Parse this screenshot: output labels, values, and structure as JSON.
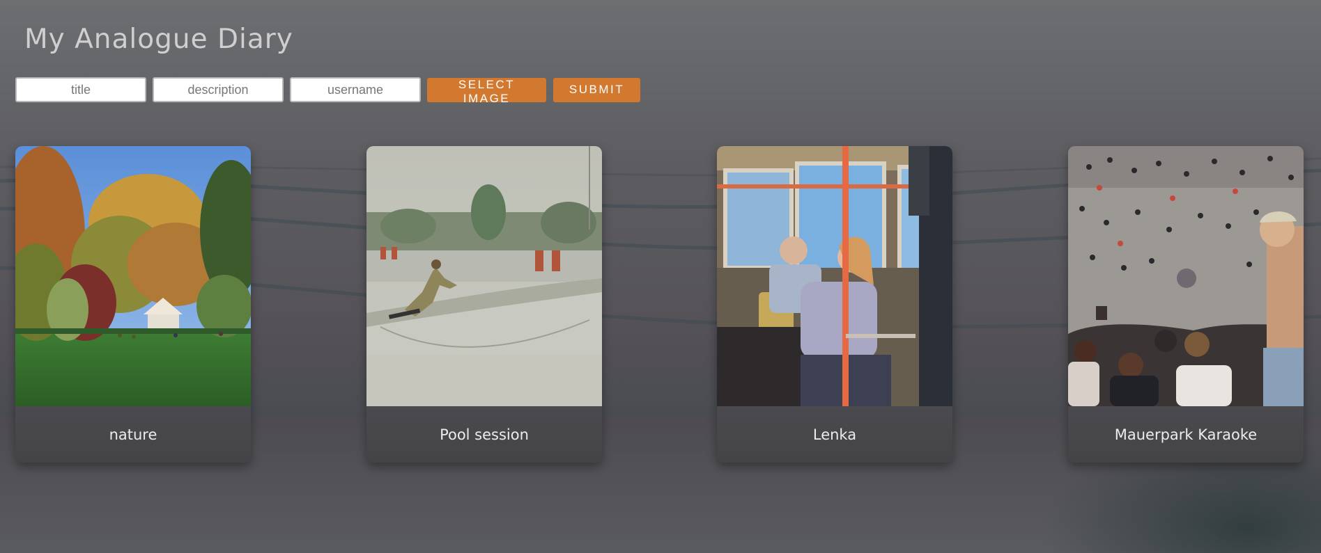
{
  "header": {
    "title": "My Analogue Diary"
  },
  "form": {
    "title_placeholder": "title",
    "description_placeholder": "description",
    "username_placeholder": "username",
    "select_label": "SELECT IMAGE",
    "submit_label": "SUBMIT",
    "accent_color": "#d2782f"
  },
  "cards": [
    {
      "title": "nature",
      "image": "park-gazebo-photo"
    },
    {
      "title": "Pool session",
      "image": "skatepark-photo"
    },
    {
      "title": "Lenka",
      "image": "tram-passengers-photo"
    },
    {
      "title": "Mauerpark Karaoke",
      "image": "crowd-amphitheater-photo"
    }
  ]
}
